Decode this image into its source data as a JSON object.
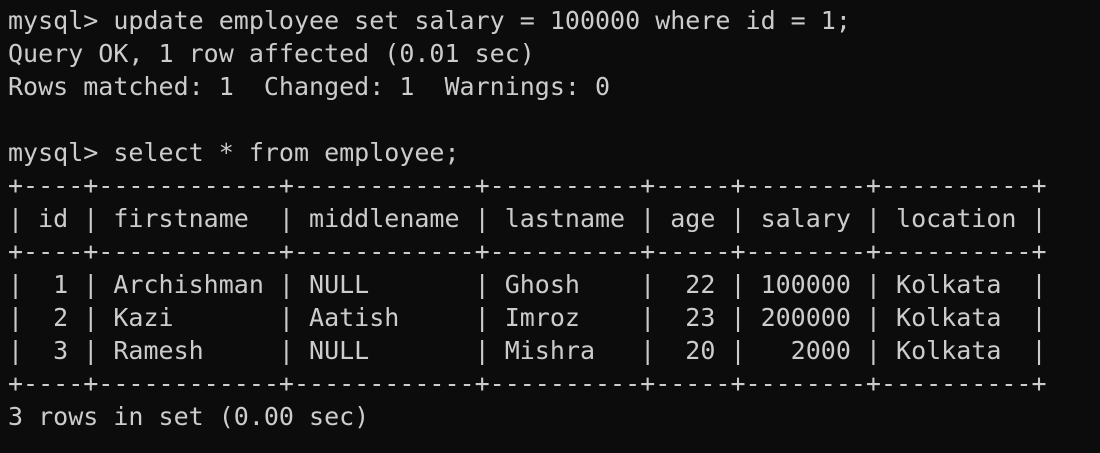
{
  "terminal": {
    "colors": {
      "background": "#0c0c0c",
      "foreground": "#cccccc"
    },
    "lines": [
      "mysql> update employee set salary = 100000 where id = 1;",
      "Query OK, 1 row affected (0.01 sec)",
      "Rows matched: 1  Changed: 1  Warnings: 0",
      "",
      "mysql> select * from employee;",
      "+----+------------+------------+----------+-----+--------+----------+",
      "| id | firstname  | middlename | lastname | age | salary | location |",
      "+----+------------+------------+----------+-----+--------+----------+",
      "|  1 | Archishman | NULL       | Ghosh    |  22 | 100000 | Kolkata  |",
      "|  2 | Kazi       | Aatish     | Imroz    |  23 | 200000 | Kolkata  |",
      "|  3 | Ramesh     | NULL       | Mishra   |  20 |   2000 | Kolkata  |",
      "+----+------------+------------+----------+-----+--------+----------+",
      "3 rows in set (0.00 sec)"
    ]
  }
}
